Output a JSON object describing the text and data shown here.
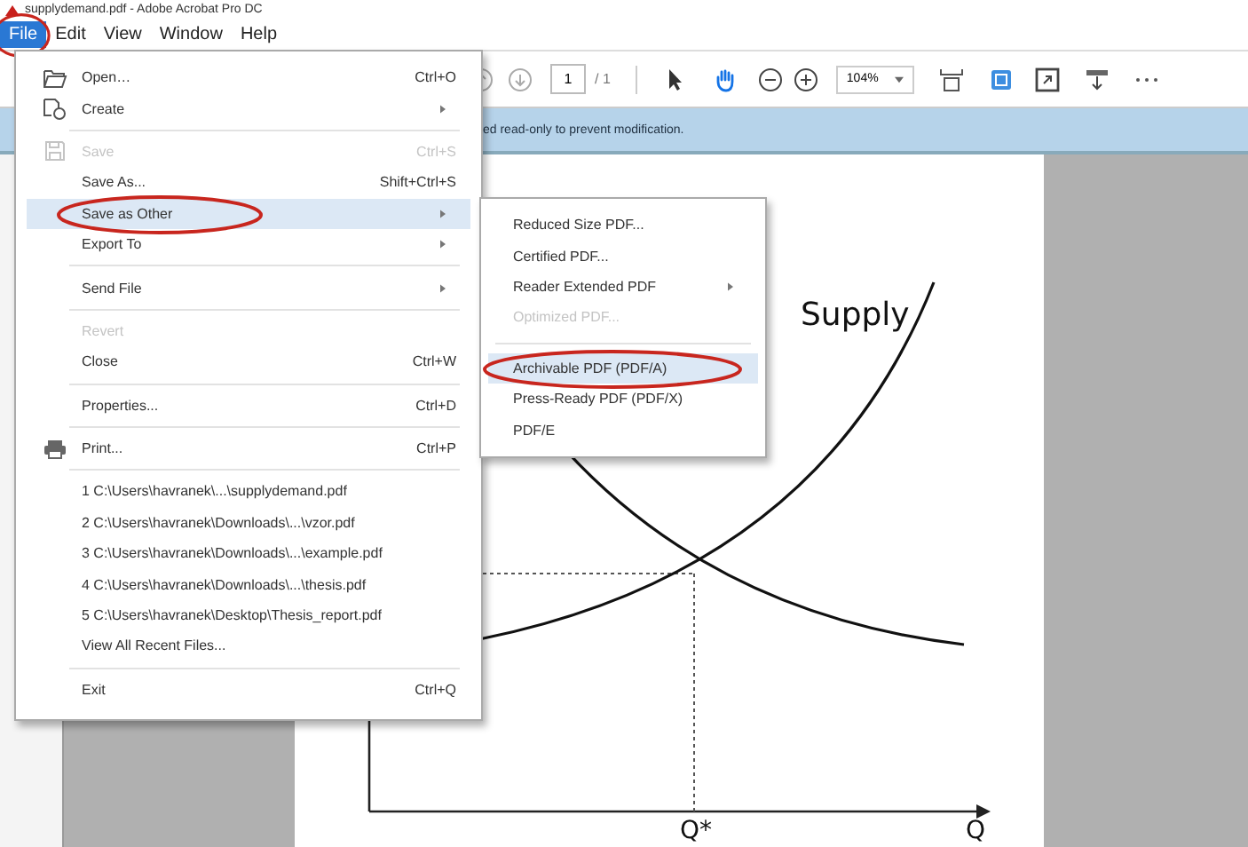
{
  "window": {
    "title": "supplydemand.pdf - Adobe Acrobat Pro DC"
  },
  "menu_bar": [
    {
      "label": "File",
      "selected": true,
      "circled": true
    },
    {
      "label": "Edit",
      "selected": false,
      "circled": false
    },
    {
      "label": "View",
      "selected": false,
      "circled": false
    },
    {
      "label": "Window",
      "selected": false,
      "circled": false
    },
    {
      "label": "Help",
      "selected": false,
      "circled": false
    }
  ],
  "toolbar": {
    "page_field": {
      "value": "1"
    },
    "page_total": "/ 1",
    "zoom_field": {
      "value": "104%"
    },
    "tools": [
      {
        "kind": "select",
        "selected": false
      },
      {
        "kind": "hand",
        "selected": true
      }
    ]
  },
  "info_bar": {
    "text": "ed read-only to prevent modification."
  },
  "file_menu": {
    "items": [
      {
        "kind": "open",
        "label": "Open…",
        "shortcut": "Ctrl+O",
        "submenu": false,
        "disabled": false,
        "highlighted": false,
        "circled": false
      },
      {
        "kind": "create",
        "label": "Create",
        "submenu": true,
        "disabled": false,
        "highlighted": false,
        "circled": false
      },
      {
        "kind": "separator"
      },
      {
        "kind": "save",
        "label": "Save",
        "shortcut": "Ctrl+S",
        "submenu": false,
        "disabled": true,
        "highlighted": false,
        "circled": false
      },
      {
        "kind": "item",
        "label": "Save As...",
        "shortcut": "Shift+Ctrl+S",
        "submenu": false,
        "disabled": false,
        "highlighted": false,
        "circled": false
      },
      {
        "kind": "item",
        "label": "Save as Other",
        "submenu": true,
        "disabled": false,
        "highlighted": true,
        "circled": true
      },
      {
        "kind": "item",
        "label": "Export To",
        "submenu": true,
        "disabled": false,
        "highlighted": false,
        "circled": false
      },
      {
        "kind": "separator"
      },
      {
        "kind": "item",
        "label": "Send File",
        "submenu": true,
        "disabled": false,
        "highlighted": false,
        "circled": false
      },
      {
        "kind": "separator"
      },
      {
        "kind": "item",
        "label": "Revert",
        "submenu": false,
        "disabled": true,
        "highlighted": false,
        "circled": false
      },
      {
        "kind": "item",
        "label": "Close",
        "shortcut": "Ctrl+W",
        "submenu": false,
        "disabled": false,
        "highlighted": false,
        "circled": false
      },
      {
        "kind": "separator"
      },
      {
        "kind": "item",
        "label": "Properties...",
        "shortcut": "Ctrl+D",
        "submenu": false,
        "disabled": false,
        "highlighted": false,
        "circled": false
      },
      {
        "kind": "separator"
      },
      {
        "kind": "print",
        "label": "Print...",
        "shortcut": "Ctrl+P",
        "submenu": false,
        "disabled": false,
        "highlighted": false,
        "circled": false
      },
      {
        "kind": "separator"
      },
      {
        "kind": "item",
        "label": "1 C:\\Users\\havranek\\...\\supplydemand.pdf",
        "submenu": false,
        "disabled": false,
        "highlighted": false,
        "circled": false
      },
      {
        "kind": "item",
        "label": "2 C:\\Users\\havranek\\Downloads\\...\\vzor.pdf",
        "submenu": false,
        "disabled": false,
        "highlighted": false,
        "circled": false
      },
      {
        "kind": "item",
        "label": "3 C:\\Users\\havranek\\Downloads\\...\\example.pdf",
        "submenu": false,
        "disabled": false,
        "highlighted": false,
        "circled": false
      },
      {
        "kind": "item",
        "label": "4 C:\\Users\\havranek\\Downloads\\...\\thesis.pdf",
        "submenu": false,
        "disabled": false,
        "highlighted": false,
        "circled": false
      },
      {
        "kind": "item",
        "label": "5 C:\\Users\\havranek\\Desktop\\Thesis_report.pdf",
        "submenu": false,
        "disabled": false,
        "highlighted": false,
        "circled": false
      },
      {
        "kind": "item",
        "label": "View All Recent Files...",
        "submenu": false,
        "disabled": false,
        "highlighted": false,
        "circled": false
      },
      {
        "kind": "separator"
      },
      {
        "kind": "item",
        "label": "Exit",
        "shortcut": "Ctrl+Q",
        "submenu": false,
        "disabled": false,
        "highlighted": false,
        "circled": false
      }
    ]
  },
  "submenu": {
    "items": [
      {
        "kind": "item",
        "label": "Reduced Size PDF...",
        "submenu": false,
        "disabled": false,
        "highlighted": false,
        "circled": false
      },
      {
        "kind": "item",
        "label": "Certified PDF...",
        "submenu": false,
        "disabled": false,
        "highlighted": false,
        "circled": false
      },
      {
        "kind": "item",
        "label": "Reader Extended PDF",
        "submenu": true,
        "disabled": false,
        "highlighted": false,
        "circled": false
      },
      {
        "kind": "item",
        "label": "Optimized PDF...",
        "submenu": false,
        "disabled": true,
        "highlighted": false,
        "circled": false
      },
      {
        "kind": "separator"
      },
      {
        "kind": "item",
        "label": "Archivable PDF (PDF/A)",
        "submenu": false,
        "disabled": false,
        "highlighted": true,
        "circled": true
      },
      {
        "kind": "item",
        "label": "Press-Ready PDF (PDF/X)",
        "submenu": false,
        "disabled": false,
        "highlighted": false,
        "circled": false
      },
      {
        "kind": "item",
        "label": "PDF/E",
        "submenu": false,
        "disabled": false,
        "highlighted": false,
        "circled": false
      }
    ]
  },
  "document": {
    "supply_label": "Supply",
    "x_labels": [
      "Q*",
      "Q"
    ]
  }
}
